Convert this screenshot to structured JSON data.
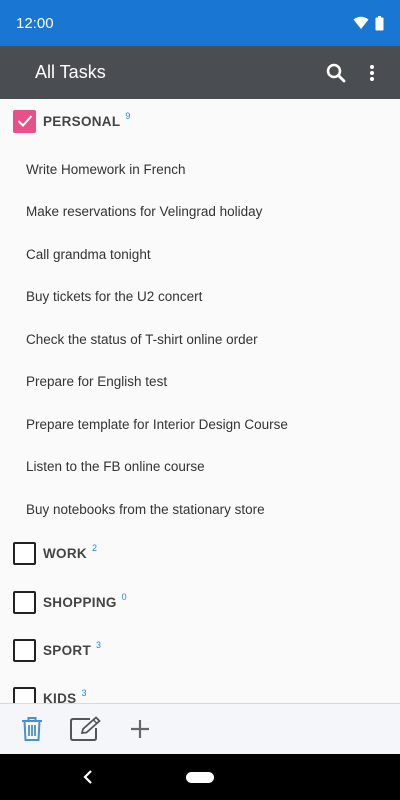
{
  "status": {
    "time": "12:00"
  },
  "app_bar": {
    "title": "All Tasks",
    "search_icon": "search-icon",
    "menu_icon": "more-vert-icon"
  },
  "categories": [
    {
      "name": "PERSONAL",
      "count": "9",
      "checked": true
    },
    {
      "name": "WORK",
      "count": "2",
      "checked": false
    },
    {
      "name": "SHOPPING",
      "count": "0",
      "checked": false
    },
    {
      "name": "SPORT",
      "count": "3",
      "checked": false
    },
    {
      "name": "KIDS",
      "count": "3",
      "checked": false
    }
  ],
  "tasks": [
    "Write Homework in French",
    "Make reservations for Velingrad holiday",
    "Call grandma tonight",
    "Buy tickets for the U2 concert",
    "Check the status of T-shirt online order",
    "Prepare for English test",
    "Prepare template for Interior Design Course",
    "Listen to the FB online course",
    "Buy notebooks from the stationary store"
  ],
  "toolbar": {
    "delete_icon": "trash-icon",
    "edit_icon": "edit-icon",
    "add_icon": "plus-icon"
  },
  "colors": {
    "status_bar": "#1976d2",
    "app_bar": "#4a4d52",
    "checked": "#e8508a",
    "count": "#1e88e5",
    "tool_icon": "#4a90c9"
  }
}
